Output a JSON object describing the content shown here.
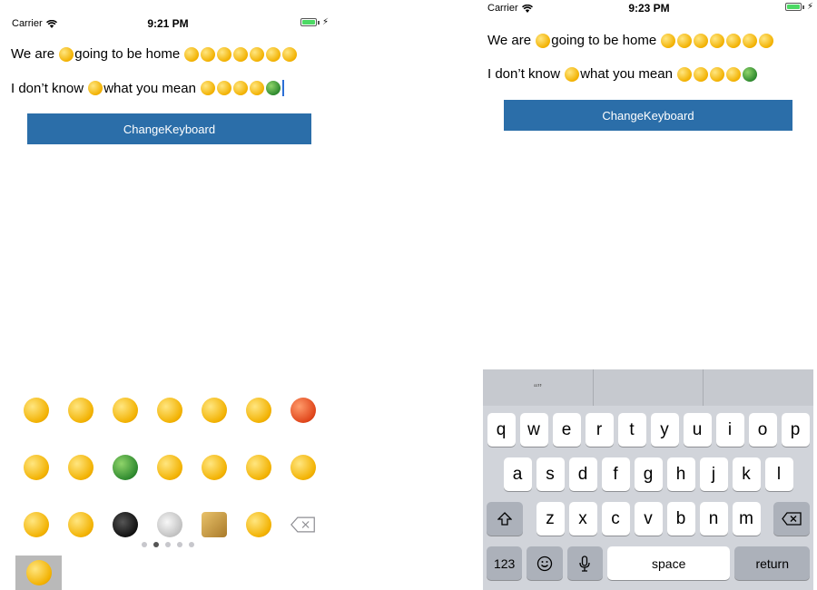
{
  "left": {
    "status": {
      "carrier": "Carrier",
      "time": "9:21 PM"
    },
    "text_lines": [
      "We are",
      "going to be home",
      "I don’t know",
      "what you mean"
    ],
    "button_label": "ChangeKeyboard",
    "page_dots": {
      "count": 5,
      "active_index": 1
    }
  },
  "right": {
    "status": {
      "carrier": "Carrier",
      "time": "9:23 PM"
    },
    "text_lines": [
      "We are",
      "going to be home",
      "I don’t know",
      "what you mean"
    ],
    "button_label": "ChangeKeyboard",
    "keyboard": {
      "prediction": [
        "“”",
        "",
        ""
      ],
      "row1": [
        "q",
        "w",
        "e",
        "r",
        "t",
        "y",
        "u",
        "i",
        "o",
        "p"
      ],
      "row2": [
        "a",
        "s",
        "d",
        "f",
        "g",
        "h",
        "j",
        "k",
        "l"
      ],
      "row3": [
        "z",
        "x",
        "c",
        "v",
        "b",
        "n",
        "m"
      ],
      "numbers_label": "123",
      "space_label": "space",
      "return_label": "return"
    }
  },
  "colors": {
    "button": "#2b6ea9",
    "caret": "#2c6fd6",
    "keyboard_bg": "#d1d4da"
  },
  "icons": [
    "wifi-icon",
    "battery-icon",
    "charging-bolt-icon",
    "shift-icon",
    "delete-icon",
    "globe-emoji-icon",
    "microphone-icon"
  ]
}
